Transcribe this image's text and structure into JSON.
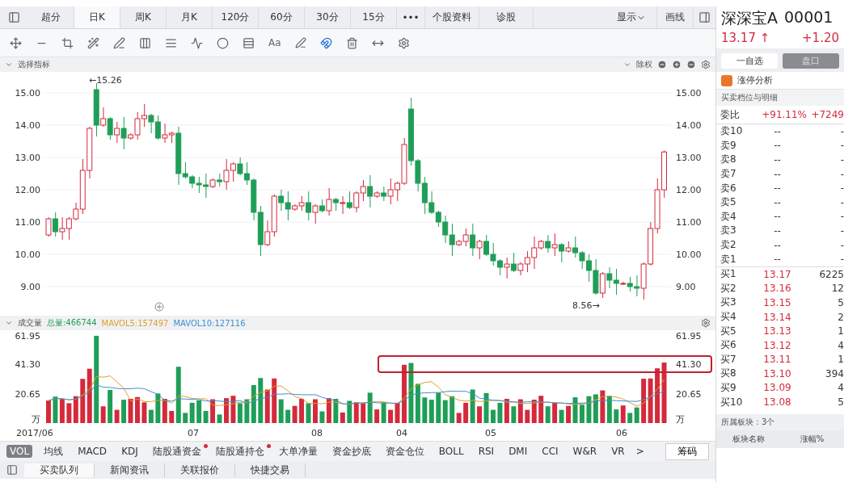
{
  "top_tabs": [
    {
      "label": "超分",
      "selected": false
    },
    {
      "label": "日K",
      "selected": true
    },
    {
      "label": "周K",
      "selected": false
    },
    {
      "label": "月K",
      "selected": false
    },
    {
      "label": "120分",
      "selected": false
    },
    {
      "label": "60分",
      "selected": false
    },
    {
      "label": "30分",
      "selected": false
    },
    {
      "label": "15分",
      "selected": false
    }
  ],
  "more": "•••",
  "extra_tabs": [
    "个股资料",
    "诊股"
  ],
  "display_menu": "显示",
  "draw_line": "画线",
  "toolbar": {
    "text_tool": "Aa"
  },
  "indicator_bar": {
    "label": "选择指标",
    "adjust": "除权"
  },
  "price_chart": {
    "left_axis": [
      "15.00",
      "14.00",
      "13.00",
      "12.00",
      "11.00",
      "10.00",
      "9.00"
    ],
    "right_axis": [
      "15.00",
      "14.00",
      "13.00",
      "12.00",
      "11.00",
      "10.00",
      "9.00"
    ],
    "high_label": "←15.26",
    "low_label": "8.56→"
  },
  "volume": {
    "title": "成交量",
    "legend": [
      {
        "text": "总量:466744",
        "color": "#1f9e57"
      },
      {
        "text": "MAVOL5:157497",
        "color": "#e0a030"
      },
      {
        "text": "MAVOL10:127116",
        "color": "#3f8fd0"
      }
    ],
    "left_axis": [
      "61.95",
      "41.30",
      "20.65",
      "万"
    ],
    "right_axis": [
      "61.95",
      "41.30",
      "20.65",
      "万"
    ],
    "dates": [
      "2017/06",
      "07",
      "08",
      "04",
      "05",
      "06"
    ]
  },
  "indicator_tabs": [
    {
      "label": "VOL",
      "selected": true,
      "dot": false
    },
    {
      "label": "均线",
      "selected": false,
      "dot": false
    },
    {
      "label": "MACD",
      "selected": false,
      "dot": false
    },
    {
      "label": "KDJ",
      "selected": false,
      "dot": false
    },
    {
      "label": "陆股通资金",
      "selected": false,
      "dot": true
    },
    {
      "label": "陆股通持仓",
      "selected": false,
      "dot": true
    },
    {
      "label": "大单净量",
      "selected": false,
      "dot": false
    },
    {
      "label": "资金抄底",
      "selected": false,
      "dot": false
    },
    {
      "label": "资金仓位",
      "selected": false,
      "dot": false
    },
    {
      "label": "BOLL",
      "selected": false,
      "dot": false
    },
    {
      "label": "RSI",
      "selected": false,
      "dot": false
    },
    {
      "label": "DMI",
      "selected": false,
      "dot": false
    },
    {
      "label": "CCI",
      "selected": false,
      "dot": false
    },
    {
      "label": "W&R",
      "selected": false,
      "dot": false
    },
    {
      "label": "VR",
      "selected": false,
      "dot": false
    }
  ],
  "next": ">",
  "chips_button": "筹码",
  "bottom_tabs": [
    {
      "label": "买卖队列",
      "selected": true
    },
    {
      "label": "新闻资讯",
      "selected": false
    },
    {
      "label": "关联报价",
      "selected": false
    },
    {
      "label": "快捷交易",
      "selected": false
    }
  ],
  "stock": {
    "name": "深深宝A",
    "code": "00001",
    "price": "13.17 ↑",
    "change": "+1.20",
    "watch_button": "一自选",
    "panel_button": "盘口",
    "limit_analysis": "涨停分析",
    "book_title": "买卖档位与明细",
    "ratio": {
      "label": "委比",
      "pct": "+91.11%",
      "diff": "+7249"
    },
    "asks": [
      {
        "label": "卖10",
        "price": "--",
        "volume": "-"
      },
      {
        "label": "卖9",
        "price": "--",
        "volume": "-"
      },
      {
        "label": "卖8",
        "price": "--",
        "volume": "-"
      },
      {
        "label": "卖7",
        "price": "--",
        "volume": "-"
      },
      {
        "label": "卖6",
        "price": "--",
        "volume": "-"
      },
      {
        "label": "卖5",
        "price": "--",
        "volume": "-"
      },
      {
        "label": "卖4",
        "price": "--",
        "volume": "-"
      },
      {
        "label": "卖3",
        "price": "--",
        "volume": "-"
      },
      {
        "label": "卖2",
        "price": "--",
        "volume": "-"
      },
      {
        "label": "卖1",
        "price": "--",
        "volume": "-"
      }
    ],
    "bids": [
      {
        "label": "买1",
        "price": "13.17",
        "volume": "6225"
      },
      {
        "label": "买2",
        "price": "13.16",
        "volume": "12"
      },
      {
        "label": "买3",
        "price": "13.15",
        "volume": "5"
      },
      {
        "label": "买4",
        "price": "13.14",
        "volume": "2"
      },
      {
        "label": "买5",
        "price": "13.13",
        "volume": "1"
      },
      {
        "label": "买6",
        "price": "13.12",
        "volume": "4"
      },
      {
        "label": "买7",
        "price": "13.11",
        "volume": "1"
      },
      {
        "label": "买8",
        "price": "13.10",
        "volume": "394"
      },
      {
        "label": "买9",
        "price": "13.09",
        "volume": "4"
      },
      {
        "label": "买10",
        "price": "13.08",
        "volume": "5"
      }
    ],
    "sectors": "所属板块：3个",
    "sector_columns": [
      "板块名称",
      "涨幅%"
    ]
  }
}
